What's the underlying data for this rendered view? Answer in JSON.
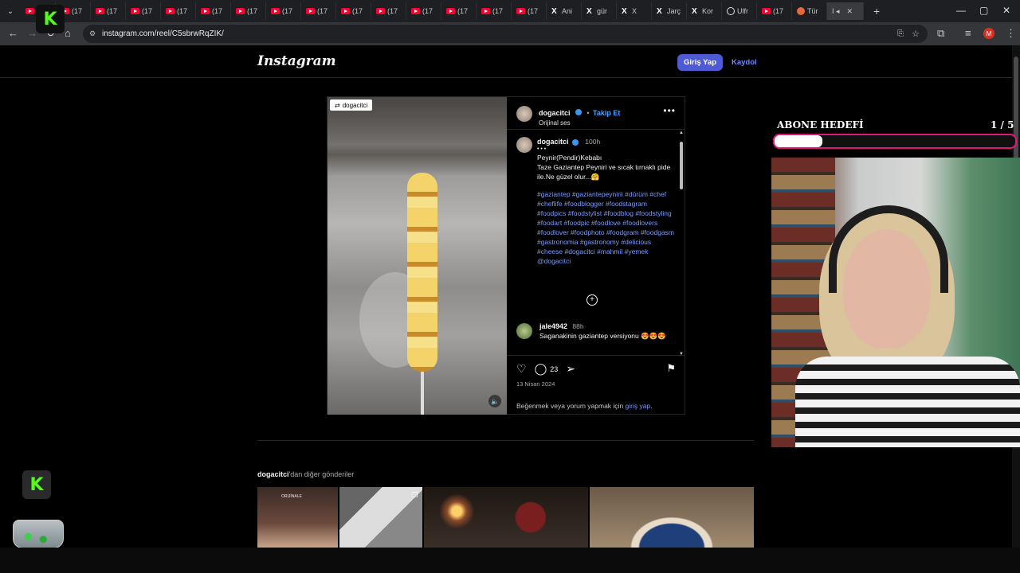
{
  "browser": {
    "tabs": [
      {
        "label": "(17",
        "icon": "youtube-icon"
      },
      {
        "label": "(17",
        "icon": "youtube-icon"
      },
      {
        "label": "(17",
        "icon": "youtube-icon"
      },
      {
        "label": "(17",
        "icon": "youtube-icon"
      },
      {
        "label": "(17",
        "icon": "youtube-icon"
      },
      {
        "label": "(17",
        "icon": "youtube-icon"
      },
      {
        "label": "(17",
        "icon": "youtube-icon"
      },
      {
        "label": "(17",
        "icon": "youtube-icon"
      },
      {
        "label": "(17",
        "icon": "youtube-icon"
      },
      {
        "label": "(17",
        "icon": "youtube-icon"
      },
      {
        "label": "(17",
        "icon": "youtube-icon"
      },
      {
        "label": "(17",
        "icon": "youtube-icon"
      },
      {
        "label": "(17",
        "icon": "youtube-icon"
      },
      {
        "label": "(17",
        "icon": "youtube-icon"
      },
      {
        "label": "(17",
        "icon": "youtube-icon"
      },
      {
        "label": "Ani",
        "icon": "x-icon"
      },
      {
        "label": "gür",
        "icon": "x-icon"
      },
      {
        "label": "X",
        "icon": "x-icon"
      },
      {
        "label": "Jarç",
        "icon": "x-icon"
      },
      {
        "label": "Kor",
        "icon": "x-icon"
      },
      {
        "label": "Ulfr",
        "icon": "globe-icon"
      },
      {
        "label": "(17",
        "icon": "youtube-icon"
      },
      {
        "label": "Tür",
        "icon": "orange-icon"
      }
    ],
    "url": "instagram.com/reel/C5sbrwRqZIK/"
  },
  "instagram": {
    "logo": "Instagram",
    "login_button": "Giriş Yap",
    "signup_link": "Kaydol",
    "post": {
      "tag": "dogacitci",
      "author": "dogacitci",
      "follow": "Takip Et",
      "audio": "Orijinal ses",
      "caption_time": "100h",
      "caption_dots": "• • •",
      "caption_lines": [
        "Peynir(Pendir)Kebabı",
        "Taze Gaziantep Peyniri ve sıcak tırnaklı pide ile.Ne güzel olur...🤗"
      ],
      "hashtags": "#gaziantep #gaziantepeynirii #dürüm #chef #cheflife #foodblogger #foodstagram #foodpics #foodstylist #foodblog #foodstyling #foodart #foodpic #foodlove #foodlovers #foodlover #foodphoto #foodgram #foodgasm #gastronomia #gastronomy #delicious #cheese #dogacitci #mahmil #yemek @dogacitci",
      "comment_user": "jale4942",
      "comment_time": "88h",
      "comment_text": "Saganakinin gaziantep versiyonu 😍😍😍",
      "comment_count": "23",
      "date": "13 Nisan 2024",
      "login_note_prefix": "Beğenmek veya yorum yapmak için ",
      "login_note_link": "giriş yap",
      "login_note_suffix": "."
    },
    "more_posts_user": "dogacitci",
    "more_posts_suffix": "'dan diğer gönderiler",
    "thumb_text": "ORİJİNALE"
  },
  "stream_overlay": {
    "goal_title": "ABONE HEDEFİ",
    "goal_count": "1 / 5",
    "goal_progress": 0.2,
    "kick_logo": "K"
  },
  "colors": {
    "accent": "#4f5bd5",
    "link": "#7a9bff",
    "goal_border": "#e0167a",
    "kick_green": "#53fc18"
  }
}
